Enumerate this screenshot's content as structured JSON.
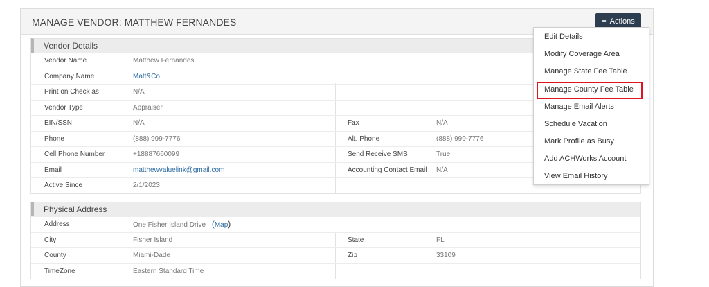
{
  "header": {
    "title": "MANAGE VENDOR: MATTHEW FERNANDES",
    "actions_label": "Actions",
    "actions_icon": "hamburger-icon"
  },
  "vendor_details": {
    "title": "Vendor Details",
    "rows": [
      {
        "label": "Vendor Name",
        "value": "Matthew Fernandes"
      },
      {
        "label": "Company Name",
        "value": "Matt&Co."
      },
      {
        "label": "Print on Check as",
        "value": "N/A"
      },
      {
        "label": "Vendor Type",
        "value": "Appraiser"
      },
      {
        "label": "EIN/SSN",
        "value": "N/A",
        "label2": "Fax",
        "value2": "N/A"
      },
      {
        "label": "Phone",
        "value": "(888) 999-7776",
        "label2": "Alt. Phone",
        "value2": "(888) 999-7776"
      },
      {
        "label": "Cell Phone Number",
        "value": "+18887660099",
        "label2": "Send Receive SMS",
        "value2": "True"
      },
      {
        "label": "Email",
        "value": "matthewvaluelink@gmail.com",
        "label2": "Accounting Contact Email",
        "value2": "N/A"
      },
      {
        "label": "Active Since",
        "value": "2/1/2023"
      }
    ]
  },
  "physical_address": {
    "title": "Physical Address",
    "rows": [
      {
        "label": "Address",
        "value": "One Fisher Island Drive",
        "open_paren": "(",
        "link": "Map",
        "close_paren": ")"
      },
      {
        "label": "City",
        "value": "Fisher Island",
        "label2": "State",
        "value2": "FL"
      },
      {
        "label": "County",
        "value": "Miami-Dade",
        "label2": "Zip",
        "value2": "33109"
      },
      {
        "label": "TimeZone",
        "value": "Eastern Standard Time"
      }
    ]
  },
  "actions_menu": {
    "items": [
      "Edit Details",
      "Modify Coverage Area",
      "Manage State Fee Table",
      "Manage County Fee Table",
      "Manage Email Alerts",
      "Schedule Vacation",
      "Mark Profile as Busy",
      "Add ACHWorks Account",
      "View Email History"
    ],
    "highlighted": "Manage County Fee Table",
    "highlight_color": "#e0141e"
  },
  "colors": {
    "actions_button": "#2d3e50",
    "link": "#2e6da4"
  }
}
